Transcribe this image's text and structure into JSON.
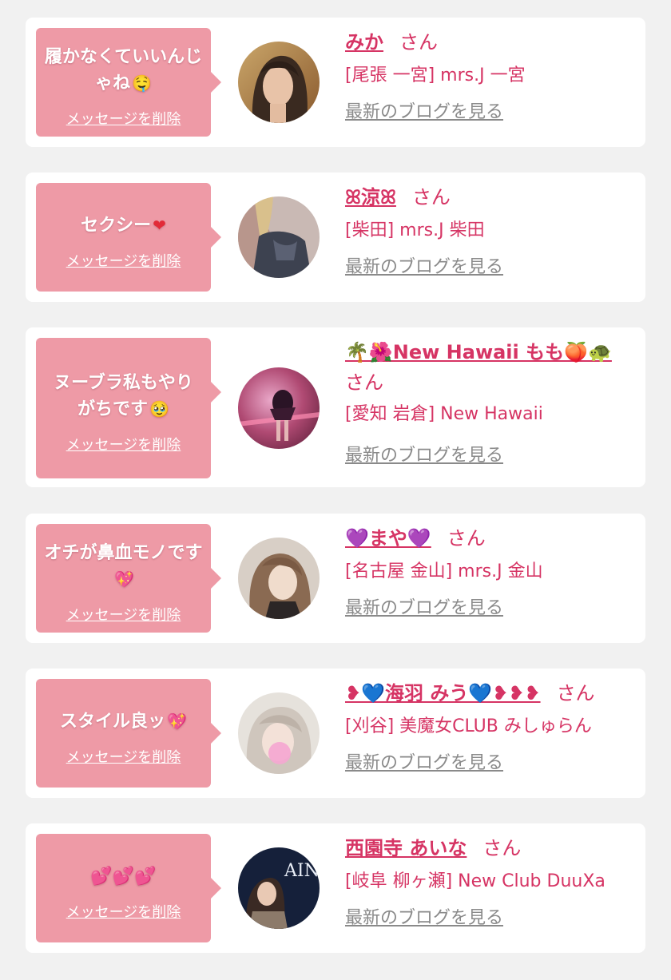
{
  "messages": [
    {
      "comment": "履かなくていいんじゃね",
      "comment_emoji": "🤤",
      "delete_label": "メッセージを削除",
      "name": "みか",
      "san": "さん",
      "shop": "[尾張 一宮] mrs.J 一宮",
      "blog_label": "最新のブログを見る"
    },
    {
      "comment": "セクシー",
      "comment_emoji": "❤",
      "delete_label": "メッセージを削除",
      "name": "ꕤ涼ꕤ",
      "san": "さん",
      "shop": "[柴田] mrs.J 柴田",
      "blog_label": "最新のブログを見る"
    },
    {
      "comment": "ヌーブラ私もやりがちです",
      "comment_emoji": "🥹",
      "delete_label": "メッセージを削除",
      "name": "🌴🌺New Hawaii もも🍑🐢",
      "san": "さん",
      "shop": "[愛知 岩倉] New Hawaii",
      "blog_label": "最新のブログを見る"
    },
    {
      "comment": "オチが鼻血モノです",
      "comment_emoji": "💖",
      "delete_label": "メッセージを削除",
      "name": "💜まや💜",
      "san": "さん",
      "shop": "[名古屋 金山] mrs.J 金山",
      "blog_label": "最新のブログを見る"
    },
    {
      "comment": "スタイル良ッ",
      "comment_emoji": "💖",
      "delete_label": "メッセージを削除",
      "name": "❥💙海羽 みう💙❥❥❥",
      "san": "さん",
      "shop": "[刈谷] 美魔女CLUB みしゅらん",
      "blog_label": "最新のブログを見る"
    },
    {
      "comment": "💕💕💕",
      "comment_emoji": "",
      "delete_label": "メッセージを削除",
      "name": "西園寺 あいな",
      "san": "さん",
      "shop": "[岐阜 柳ヶ瀬] New Club DuuXa",
      "blog_label": "最新のブログを見る"
    }
  ],
  "avatar_texts": {
    "m5_brand": "AINA"
  },
  "colors": {
    "page_bg": "#f1f1f1",
    "card_bg": "#ffffff",
    "bubble_bg": "#ee9aa6",
    "accent": "#d63464",
    "link_gray": "#8a8a8a"
  }
}
